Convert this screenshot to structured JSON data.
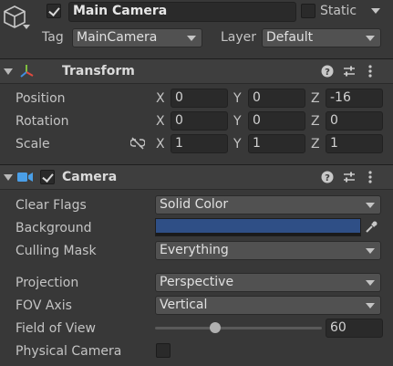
{
  "header": {
    "enabled": true,
    "object_name": "Main Camera",
    "static_label": "Static",
    "static_checked": false,
    "tag_label": "Tag",
    "tag_value": "MainCamera",
    "layer_label": "Layer",
    "layer_value": "Default"
  },
  "transform": {
    "title": "Transform",
    "rows": [
      {
        "label": "Position",
        "x": "0",
        "y": "0",
        "z": "-16"
      },
      {
        "label": "Rotation",
        "x": "0",
        "y": "0",
        "z": "0"
      },
      {
        "label": "Scale",
        "x": "1",
        "y": "1",
        "z": "1"
      }
    ],
    "axis_labels": {
      "x": "X",
      "y": "Y",
      "z": "Z"
    }
  },
  "camera": {
    "title": "Camera",
    "enabled": true,
    "clear_flags_label": "Clear Flags",
    "clear_flags_value": "Solid Color",
    "background_label": "Background",
    "background_color": "#2f4f86",
    "culling_mask_label": "Culling Mask",
    "culling_mask_value": "Everything",
    "projection_label": "Projection",
    "projection_value": "Perspective",
    "fov_axis_label": "FOV Axis",
    "fov_axis_value": "Vertical",
    "fov_label": "Field of View",
    "fov_value": "60",
    "fov_slider_fraction": 0.35,
    "physical_camera_label": "Physical Camera",
    "physical_camera_checked": false
  },
  "icons": {
    "gameobject": "cube-icon",
    "transform": "transform-axes-icon",
    "camera": "camera-icon",
    "help": "help-icon",
    "presets": "presets-icon",
    "menu": "kebab-menu-icon",
    "constrain": "constrain-proportions-icon",
    "eyedropper": "eyedropper-icon"
  },
  "colors": {
    "panel_bg": "#383838",
    "field_bg": "#2a2a2a",
    "dropdown_bg": "#515151",
    "accent_blue": "#4a9fe8"
  }
}
